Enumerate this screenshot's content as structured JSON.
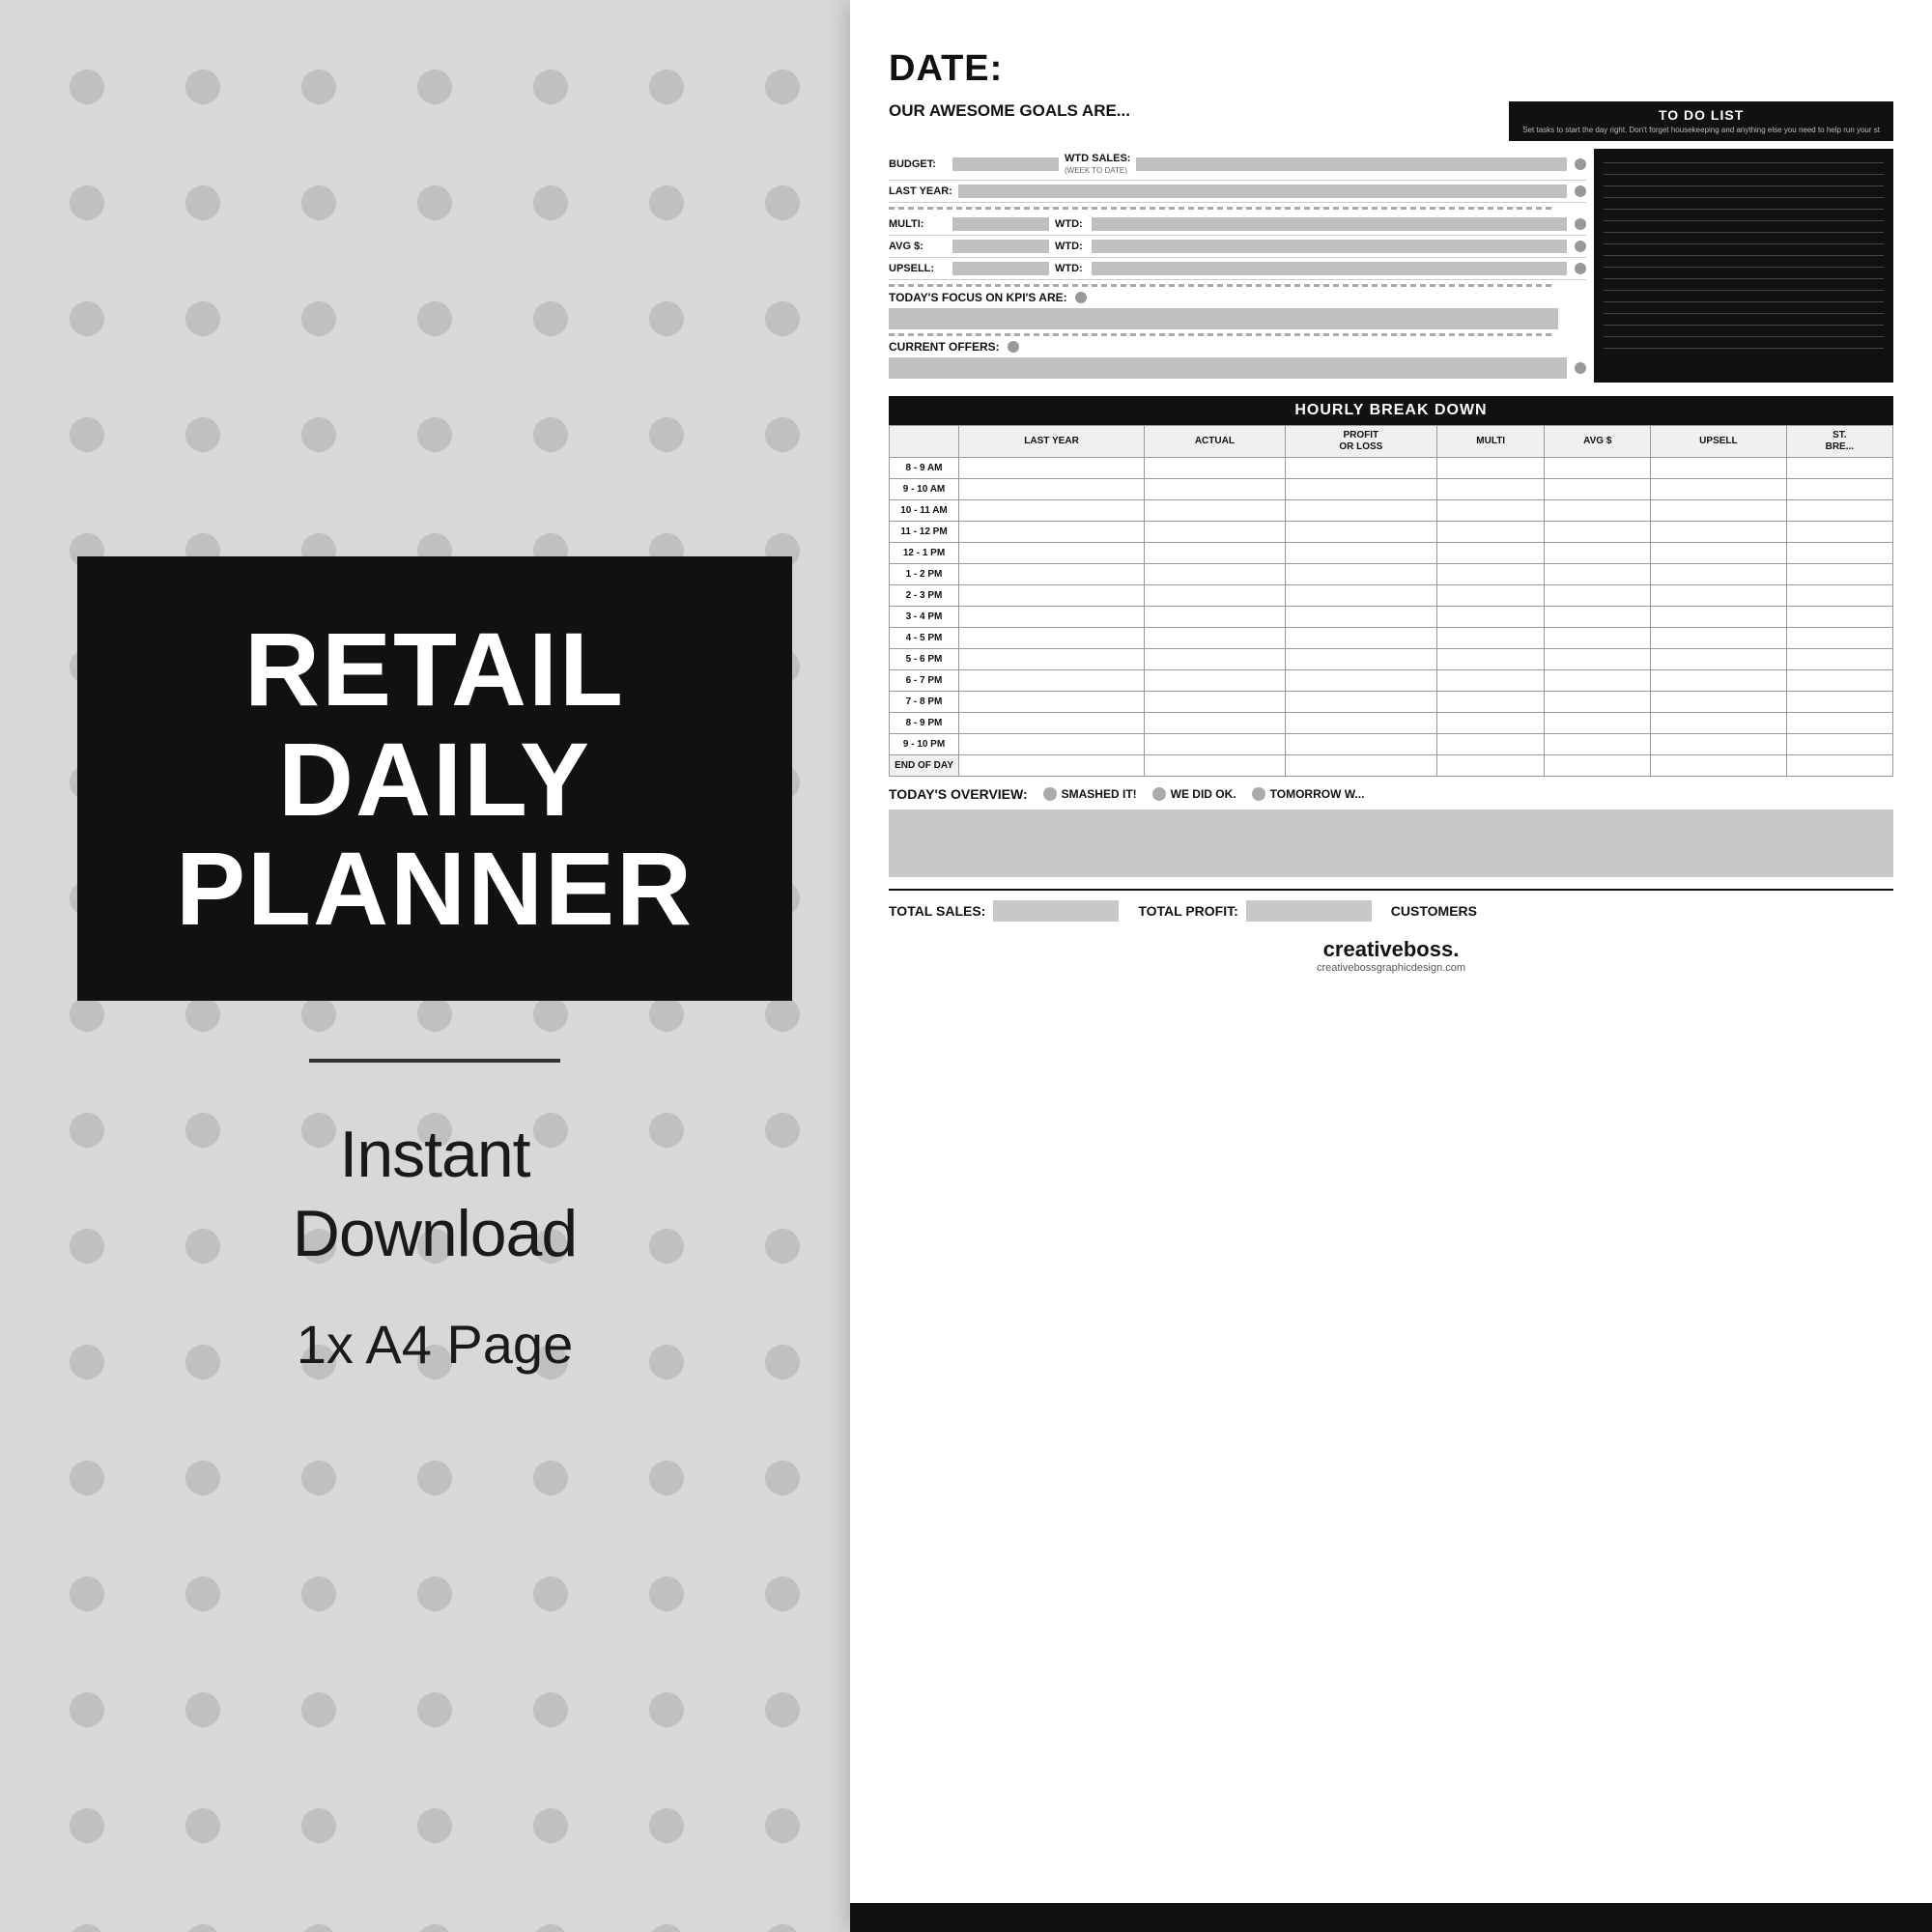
{
  "background": {
    "color": "#d4d4d4"
  },
  "left_panel": {
    "black_box": {
      "line1": "RETAIL",
      "line2": "DAILY",
      "line3": "PLANNER"
    },
    "subtitle_line1": "Instant",
    "subtitle_line2": "Download",
    "page_info": "1x A4 Page"
  },
  "planner": {
    "date_label": "DATE:",
    "goals_title": "OUR AWESOME GOALS ARE...",
    "todo_title": "TO DO LIST",
    "todo_description": "Set tasks to start the day right. Don't forget housekeeping and anything else you need to help run your st",
    "budget_label": "BUDGET:",
    "wtd_sales_label": "WTD SALES:",
    "wtd_sales_sub": "(WEEK TO DATE)",
    "last_year_label": "LAST YEAR:",
    "multi_label": "MULTI:",
    "wtd_label": "WTD:",
    "avg_label": "AVG $:",
    "wtd2_label": "WTD:",
    "upsell_label": "UPSELL:",
    "wtd3_label": "WTD:",
    "kpi_label": "TODAY'S FOCUS ON KPI'S ARE:",
    "offers_label": "CURRENT OFFERS:",
    "hourly_header": "HOURLY BREAK DOWN",
    "table_headers": {
      "time": "",
      "last_year": "LAST YEAR",
      "actual": "ACTUAL",
      "profit_or_loss": "PROFIT OR LOSS",
      "multi": "MULTI",
      "avg": "AVG $",
      "upsell": "UPSELL",
      "st_bre": "ST. BRE..."
    },
    "time_slots": [
      "8 - 9 AM",
      "9 - 10 AM",
      "10 - 11 AM",
      "11 - 12 PM",
      "12 - 1 PM",
      "1 - 2 PM",
      "2 - 3 PM",
      "3 - 4 PM",
      "4 - 5 PM",
      "5 - 6 PM",
      "6 - 7 PM",
      "7 - 8 PM",
      "8 - 9 PM",
      "9 - 10 PM",
      "END OF DAY"
    ],
    "overview_label": "TODAY'S OVERVIEW:",
    "overview_options": [
      "SMASHED IT!",
      "WE DID OK.",
      "TOMORROW W..."
    ],
    "total_sales_label": "TOTAL SALES:",
    "total_profit_label": "TOTAL PROFIT:",
    "customers_label": "CUSTOMERS",
    "brand_name_plain": "creative",
    "brand_name_bold": "boss.",
    "brand_url": "creativebossgraphicdesign.com"
  }
}
